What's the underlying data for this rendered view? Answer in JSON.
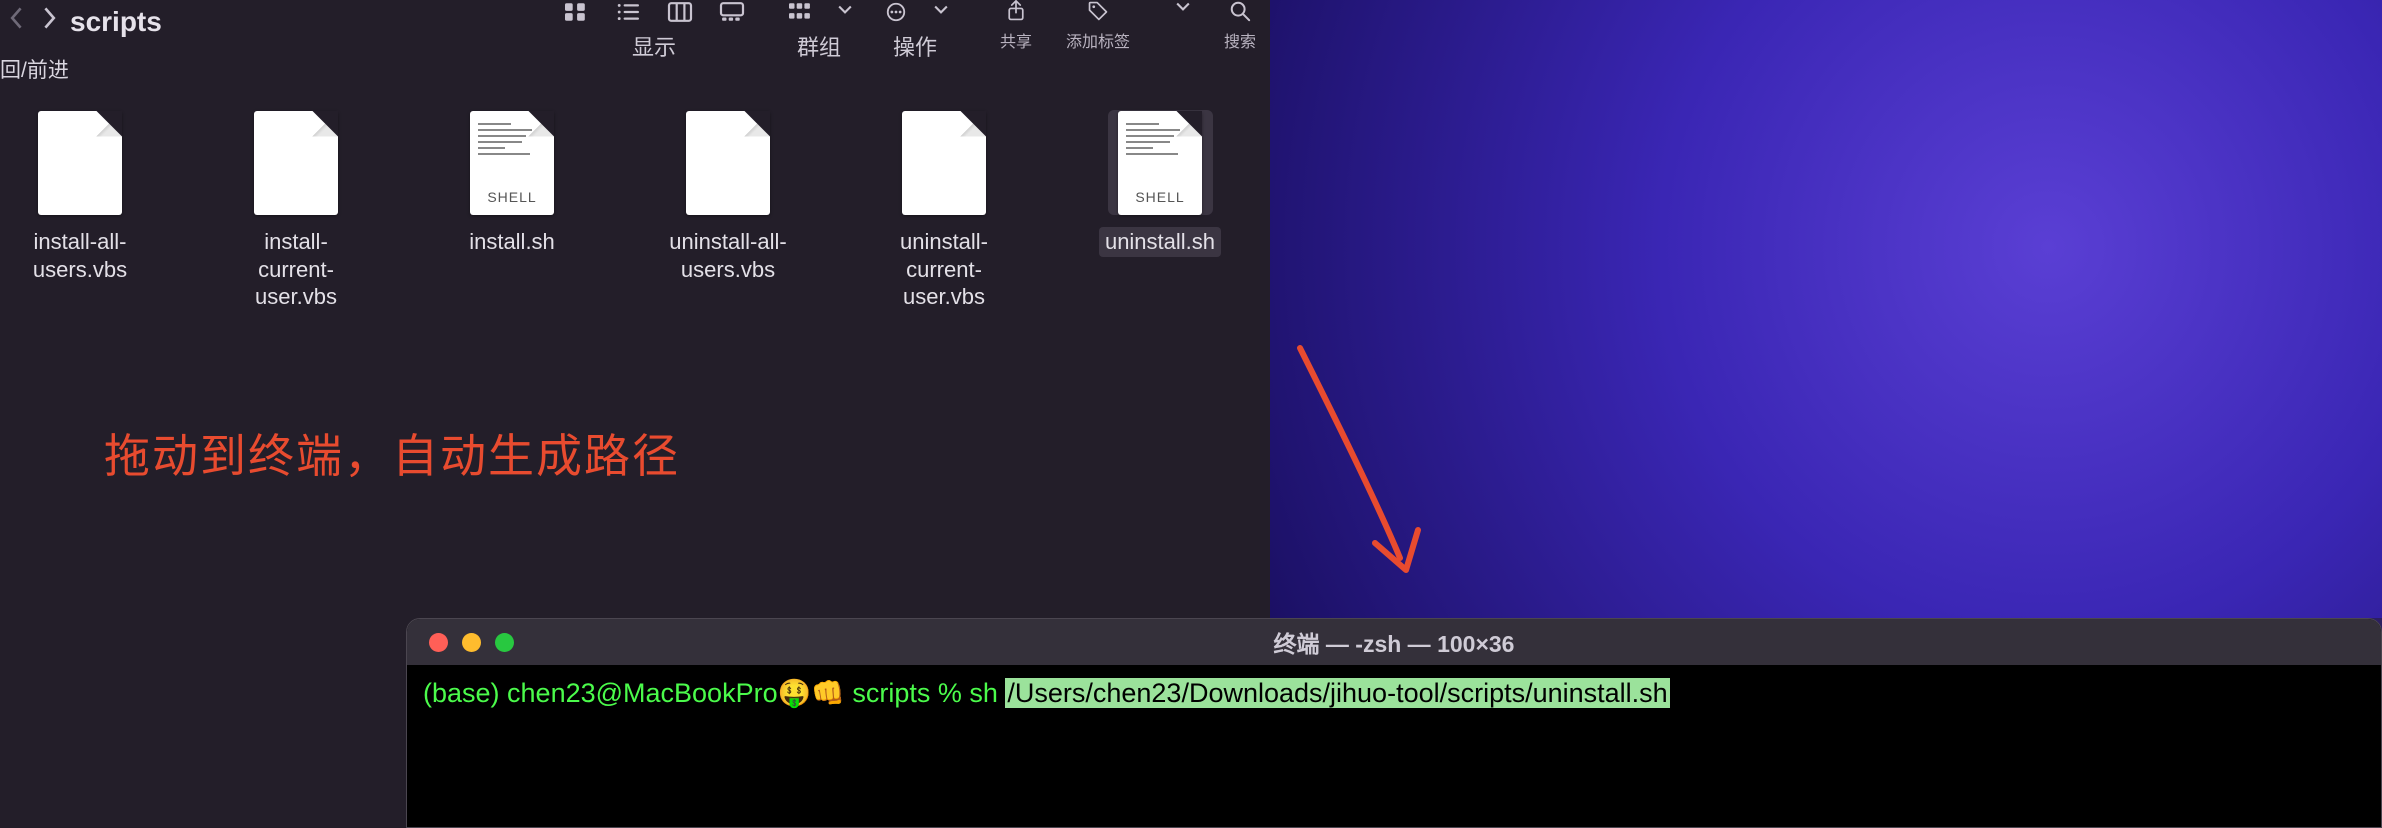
{
  "finder": {
    "nav_sub": "回/前进",
    "title": "scripts",
    "toolbar": {
      "view_label": "显示",
      "group_label": "群组",
      "action_label": "操作",
      "share_label": "共享",
      "tag_label": "添加标签",
      "search_label": "搜索"
    },
    "files": [
      {
        "name": "install-all-users.vbs",
        "kind": "vbs"
      },
      {
        "name": "install-current-user.vbs",
        "kind": "vbs"
      },
      {
        "name": "install.sh",
        "kind": "shell"
      },
      {
        "name": "uninstall-all-users.vbs",
        "kind": "vbs"
      },
      {
        "name": "uninstall-current-user.vbs",
        "kind": "vbs"
      },
      {
        "name": "uninstall.sh",
        "kind": "shell",
        "selected": true
      }
    ],
    "thumb_badge": "SHELL"
  },
  "annotation": {
    "text": "拖动到终端，自动生成路径"
  },
  "terminal": {
    "title": "终端 — -zsh — 100×36",
    "prompt": "(base) chen23@MacBookPro🤑👊 scripts % sh ",
    "path": "/Users/chen23/Downloads/jihuo-tool/scripts/uninstall.sh"
  }
}
